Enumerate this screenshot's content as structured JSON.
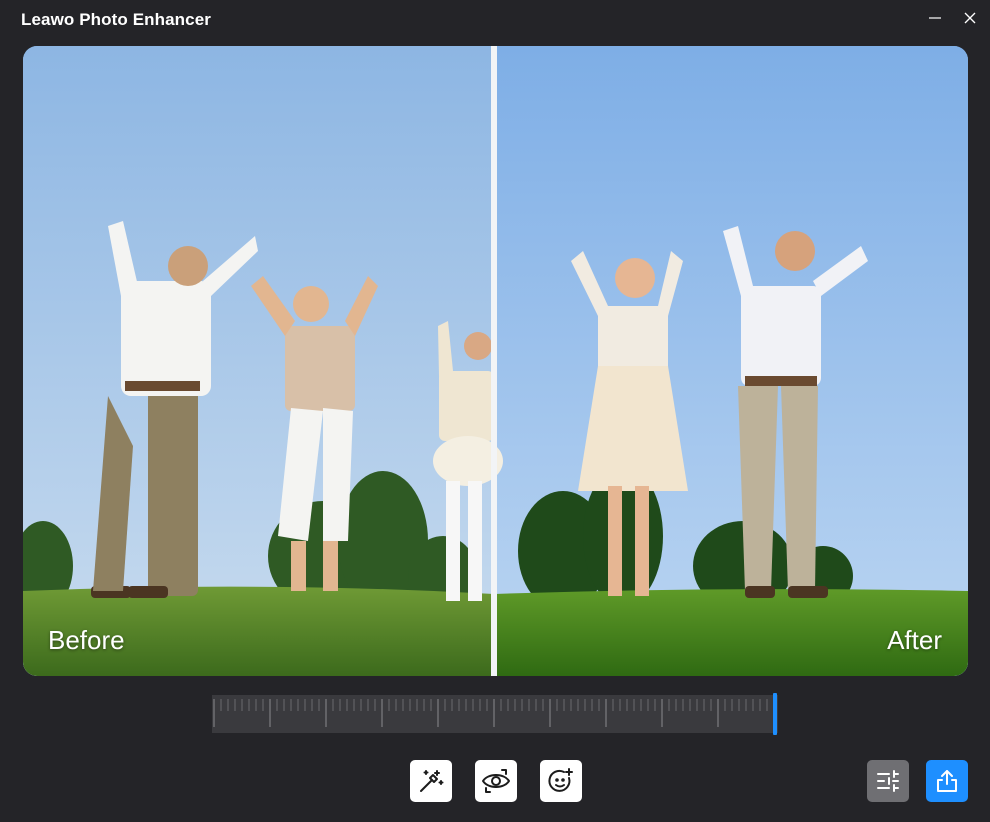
{
  "window": {
    "title": "Leawo Photo Enhancer",
    "minimize_icon": "minimize-icon",
    "close_icon": "close-icon"
  },
  "preview": {
    "before_label": "Before",
    "after_label": "After",
    "divider_position": 0.5
  },
  "timeline": {
    "position": 1.0
  },
  "toolbar": {
    "buttons": [
      {
        "icon": "magic-wand-icon"
      },
      {
        "icon": "eye-icon"
      },
      {
        "icon": "face-sparkle-icon"
      }
    ],
    "right_buttons": [
      {
        "icon": "sliders-icon"
      },
      {
        "icon": "export-icon"
      }
    ]
  },
  "colors": {
    "background": "#242428",
    "accent": "#1e8fff",
    "adjust_button": "#6f6f73"
  }
}
